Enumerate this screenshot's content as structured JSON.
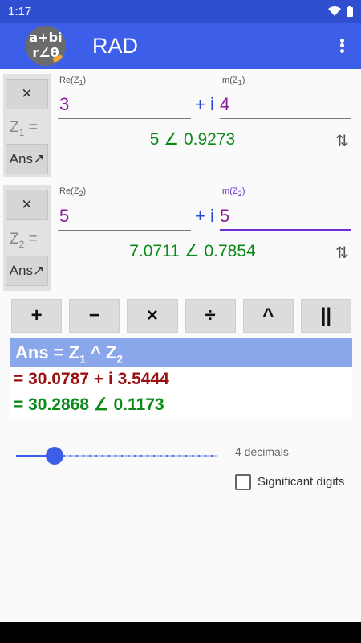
{
  "status": {
    "time": "1:17"
  },
  "appbar": {
    "logo_top": "a+bi",
    "logo_bottom": "r∠θ",
    "title": "RAD"
  },
  "z1": {
    "clear_label": "✕",
    "label": "Z",
    "sub": "1",
    "eq": " =",
    "ans_label": "Ans↗",
    "re_label": "Re(Z",
    "re_label_sub": "1",
    "im_label": "Im(Z",
    "im_label_sub": "1",
    "re_value": "3",
    "plus_i": "+ i",
    "im_value": "4",
    "polar": "5 ∠ 0.9273",
    "swap": "⇅"
  },
  "z2": {
    "clear_label": "✕",
    "label": "Z",
    "sub": "2",
    "eq": " =",
    "ans_label": "Ans↗",
    "re_label": "Re(Z",
    "re_label_sub": "2",
    "im_label": "Im(Z",
    "im_label_sub": "2",
    "re_value": "5",
    "plus_i": "+ i",
    "im_value": "5",
    "polar": "7.0711 ∠ 0.7854",
    "swap": "⇅"
  },
  "operations": [
    "+",
    "−",
    "×",
    "÷",
    "^",
    "||"
  ],
  "answer": {
    "header_a": "Ans = Z",
    "header_sub1": "1",
    "header_b": " ^ Z",
    "header_sub2": "2",
    "rectangular": "= 30.0787 + i 3.5444",
    "polar": "= 30.2868  ∠ 0.1173"
  },
  "precision": {
    "decimals_label": "4 decimals",
    "slider_fraction": 0.19
  },
  "significant": {
    "label": "Significant digits",
    "checked": false
  },
  "colors": {
    "accent": "#3d5ee8",
    "status_bar": "#2f4fd0",
    "answer_bar": "#8aa7ec",
    "rect_result": "#9a1010",
    "polar_result": "#0a8a18",
    "input_value": "#8a1a9a"
  }
}
